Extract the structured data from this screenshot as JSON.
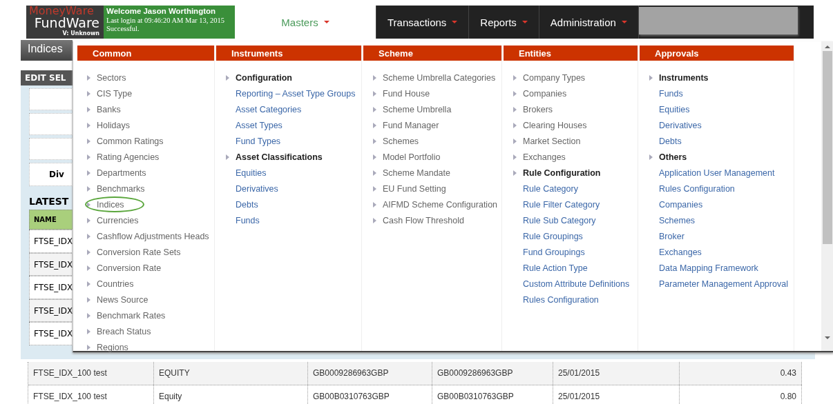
{
  "header": {
    "logo": {
      "top": "MoneyWare",
      "main": "FundWare",
      "version": "V: Unknown"
    },
    "welcome": {
      "title": "Welcome Jason Worthington",
      "login": "Last login at 09:46:20 AM Mar 13, 2015",
      "status": "Successful."
    },
    "nav": [
      {
        "label": "Masters",
        "selected": true
      },
      {
        "label": "Transactions",
        "selected": false
      },
      {
        "label": "Reports",
        "selected": false
      },
      {
        "label": "Administration",
        "selected": false
      }
    ]
  },
  "page": {
    "tab": "Indices",
    "section_title": "EDIT SEL",
    "form_label": "Div",
    "list_title": "LATEST",
    "table_header": "NAME",
    "covered_rows": [
      "FTSE_IDX",
      "FTSE_IDX",
      "FTSE_IDX",
      "FTSE_IDX",
      "FTSE_IDX"
    ],
    "rows": [
      [
        "FTSE_IDX_100 test",
        "EQUITY",
        "GB0009286963GBP",
        "GB0009286963GBP",
        "25/01/2015",
        "0.43"
      ],
      [
        "FTSE_IDX_100 test",
        "Equity",
        "GB00B0310763GBP",
        "GB00B0310763GBP",
        "25/01/2015",
        "0.80"
      ]
    ]
  },
  "menu": {
    "columns": [
      {
        "title": "Common",
        "items": [
          {
            "label": "Sectors",
            "kind": "leaf",
            "circled": false
          },
          {
            "label": "CIS Type",
            "kind": "leaf",
            "circled": false
          },
          {
            "label": "Banks",
            "kind": "leaf",
            "circled": false
          },
          {
            "label": "Holidays",
            "kind": "leaf",
            "circled": false
          },
          {
            "label": "Common Ratings",
            "kind": "leaf",
            "circled": false
          },
          {
            "label": "Rating Agencies",
            "kind": "leaf",
            "circled": false
          },
          {
            "label": "Departments",
            "kind": "leaf",
            "circled": false
          },
          {
            "label": "Benchmarks",
            "kind": "leaf",
            "circled": false
          },
          {
            "label": "Indices",
            "kind": "leaf",
            "circled": true
          },
          {
            "label": "Currencies",
            "kind": "leaf",
            "circled": false
          },
          {
            "label": "Cashflow Adjustments Heads",
            "kind": "leaf",
            "circled": false
          },
          {
            "label": "Conversion Rate Sets",
            "kind": "leaf",
            "circled": false
          },
          {
            "label": "Conversion Rate",
            "kind": "leaf",
            "circled": false
          },
          {
            "label": "Countries",
            "kind": "leaf",
            "circled": false
          },
          {
            "label": "News Source",
            "kind": "leaf",
            "circled": false
          },
          {
            "label": "Benchmark Rates",
            "kind": "leaf",
            "circled": false
          },
          {
            "label": "Breach Status",
            "kind": "leaf",
            "circled": false
          },
          {
            "label": "Regions",
            "kind": "leaf",
            "circled": false
          }
        ]
      },
      {
        "title": "Instruments",
        "items": [
          {
            "label": "Configuration",
            "kind": "group"
          },
          {
            "label": "Reporting – Asset Type Groups",
            "kind": "link"
          },
          {
            "label": "Asset Categories",
            "kind": "link"
          },
          {
            "label": "Asset Types",
            "kind": "link"
          },
          {
            "label": "Fund Types",
            "kind": "link"
          },
          {
            "label": "Asset Classifications",
            "kind": "group"
          },
          {
            "label": "Equities",
            "kind": "link"
          },
          {
            "label": "Derivatives",
            "kind": "link"
          },
          {
            "label": "Debts",
            "kind": "link"
          },
          {
            "label": "Funds",
            "kind": "link"
          }
        ]
      },
      {
        "title": "Scheme",
        "items": [
          {
            "label": "Scheme Umbrella Categories",
            "kind": "leaf"
          },
          {
            "label": "Fund House",
            "kind": "leaf"
          },
          {
            "label": "Scheme Umbrella",
            "kind": "leaf"
          },
          {
            "label": "Fund Manager",
            "kind": "leaf"
          },
          {
            "label": "Schemes",
            "kind": "leaf"
          },
          {
            "label": "Model Portfolio",
            "kind": "leaf"
          },
          {
            "label": "Scheme Mandate",
            "kind": "leaf"
          },
          {
            "label": "EU Fund Setting",
            "kind": "leaf"
          },
          {
            "label": "AIFMD Scheme Configuration",
            "kind": "leaf"
          },
          {
            "label": "Cash Flow Threshold",
            "kind": "leaf"
          }
        ]
      },
      {
        "title": "Entities",
        "items": [
          {
            "label": "Company Types",
            "kind": "leaf"
          },
          {
            "label": "Companies",
            "kind": "leaf"
          },
          {
            "label": "Brokers",
            "kind": "leaf"
          },
          {
            "label": "Clearing Houses",
            "kind": "leaf"
          },
          {
            "label": "Market Section",
            "kind": "leaf"
          },
          {
            "label": "Exchanges",
            "kind": "leaf"
          },
          {
            "label": "Rule Configuration",
            "kind": "group"
          },
          {
            "label": "Rule Category",
            "kind": "link"
          },
          {
            "label": "Rule Filter Category",
            "kind": "link"
          },
          {
            "label": "Rule Sub Category",
            "kind": "link"
          },
          {
            "label": "Rule Groupings",
            "kind": "link"
          },
          {
            "label": "Fund Groupings",
            "kind": "link"
          },
          {
            "label": "Rule Action Type",
            "kind": "link"
          },
          {
            "label": "Custom Attribute Definitions",
            "kind": "link"
          },
          {
            "label": "Rules Configuration",
            "kind": "link"
          }
        ]
      },
      {
        "title": "Approvals",
        "items": [
          {
            "label": "Instruments",
            "kind": "group"
          },
          {
            "label": "Funds",
            "kind": "link"
          },
          {
            "label": "Equities",
            "kind": "link"
          },
          {
            "label": "Derivatives",
            "kind": "link"
          },
          {
            "label": "Debts",
            "kind": "link"
          },
          {
            "label": "Others",
            "kind": "group"
          },
          {
            "label": "Application User Management",
            "kind": "link"
          },
          {
            "label": "Rules Configuration",
            "kind": "link"
          },
          {
            "label": "Companies",
            "kind": "link"
          },
          {
            "label": "Schemes",
            "kind": "link"
          },
          {
            "label": "Broker",
            "kind": "link"
          },
          {
            "label": "Exchanges",
            "kind": "link"
          },
          {
            "label": "Data Mapping Framework",
            "kind": "link"
          },
          {
            "label": "Parameter Management Approval",
            "kind": "link"
          }
        ]
      }
    ]
  }
}
